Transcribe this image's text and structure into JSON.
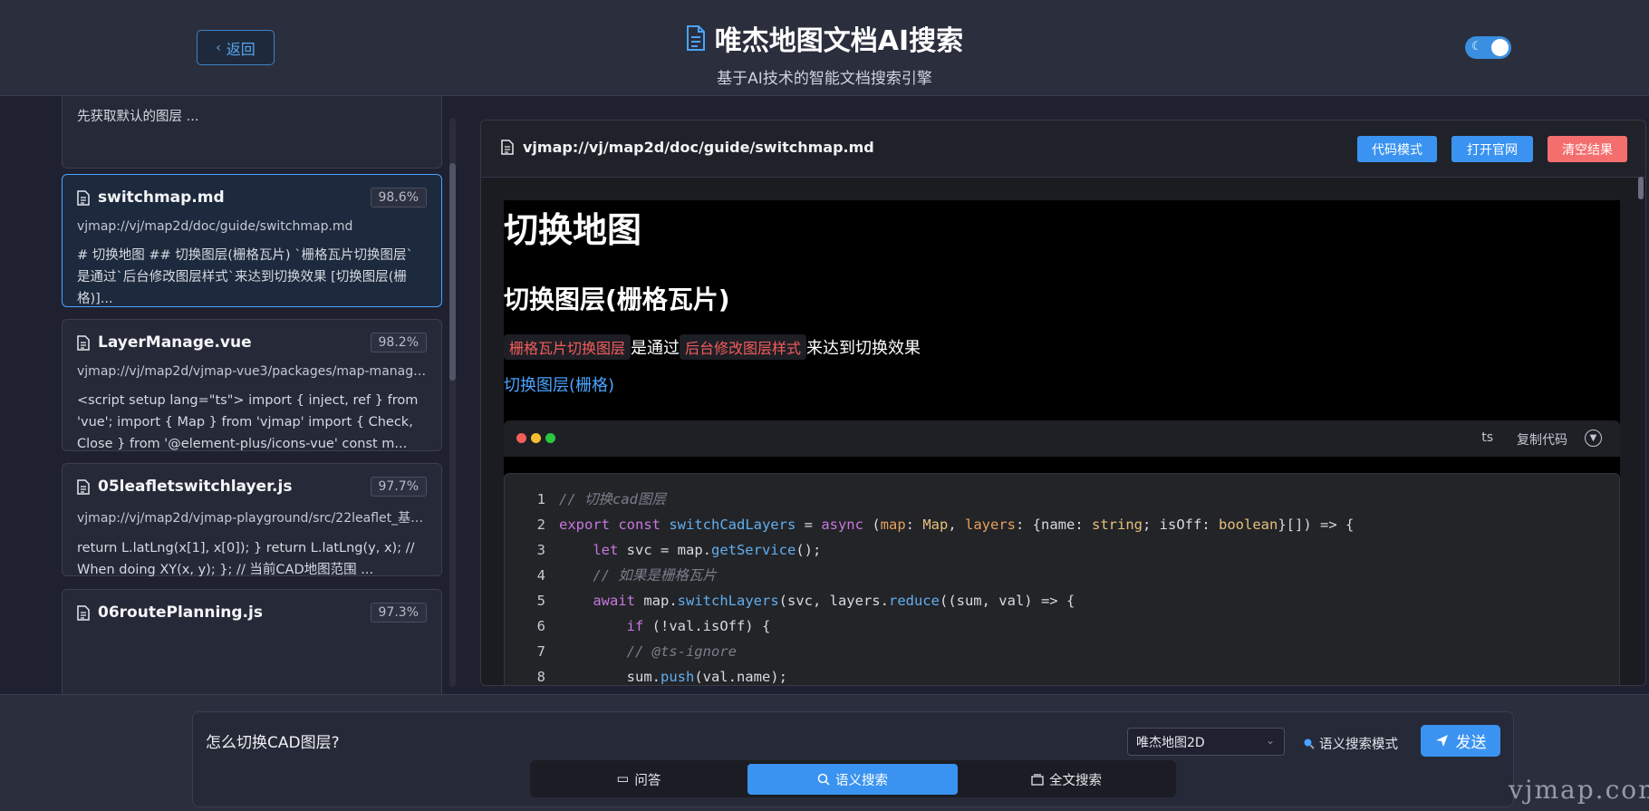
{
  "header": {
    "back_label": "返回",
    "title": "唯杰地图文档AI搜索",
    "subtitle": "基于AI技术的智能文档搜索引擎",
    "theme_toggle_icon": "moon-icon"
  },
  "results": {
    "partial_top": {
      "line1": "... ... .. .. ... ... ... ... .. ...",
      "line2": "先获取默认的图层 ..."
    },
    "items": [
      {
        "name": "switchmap.md",
        "score": "98.6%",
        "path": "vjmap://vj/map2d/doc/guide/switchmap.md",
        "snippet": "# 切换地图 ## 切换图层(栅格瓦片) `栅格瓦片切换图层` 是通过`后台修改图层样式`来达到切换效果 [切换图层(栅格)]..."
      },
      {
        "name": "LayerManage.vue",
        "score": "98.2%",
        "path": "vjmap://vj/map2d/vjmap-vue3/packages/map-manage/s...",
        "snippet": "<script setup lang=\"ts\"> import { inject, ref } from 'vue'; import { Map } from 'vjmap' import { Check, Close } from '@element-plus/icons-vue' const m..."
      },
      {
        "name": "05leafletswitchlayer.js",
        "score": "97.7%",
        "path": "vjmap://vj/map2d/vjmap-playground/src/22leaflet_基于L...",
        "snippet": "return L.latLng(x[1], x[0]); } return L.latLng(y, x); // When doing XY(x, y); }; // 当前CAD地图范围 ..."
      },
      {
        "name": "06routePlanning.js",
        "score": "97.3%"
      }
    ]
  },
  "panel": {
    "path": "vjmap://vj/map2d/doc/guide/switchmap.md",
    "code_mode_label": "代码模式",
    "open_site_label": "打开官网",
    "clear_label": "清空结果",
    "doc": {
      "h1": "切换地图",
      "h2": "切换图层(栅格瓦片)",
      "code1": "栅格瓦片切换图层",
      "text1": "是通过",
      "code2": "后台修改图层样式",
      "text2": "来达到切换效果",
      "link": "切换图层(栅格)"
    },
    "code_block": {
      "lang": "ts",
      "copy_label": "复制代码",
      "lines": [
        {
          "n": "1"
        },
        {
          "n": "2"
        },
        {
          "n": "3"
        },
        {
          "n": "4"
        },
        {
          "n": "5"
        },
        {
          "n": "6"
        },
        {
          "n": "7"
        },
        {
          "n": "8"
        }
      ]
    }
  },
  "search": {
    "query": "怎么切换CAD图层?",
    "library_selected": "唯杰地图2D",
    "mode_label": "语义搜索模式",
    "send_label": "发送",
    "tabs": [
      {
        "label": "问答",
        "icon": "chat-icon"
      },
      {
        "label": "语义搜索",
        "icon": "search-icon"
      },
      {
        "label": "全文搜索",
        "icon": "files-icon"
      }
    ],
    "active_tab": "语义搜索"
  },
  "watermark": "vjmap.com",
  "colors": {
    "accent": "#3a93f0",
    "danger": "#f46e6e",
    "background": "#1f2130"
  }
}
